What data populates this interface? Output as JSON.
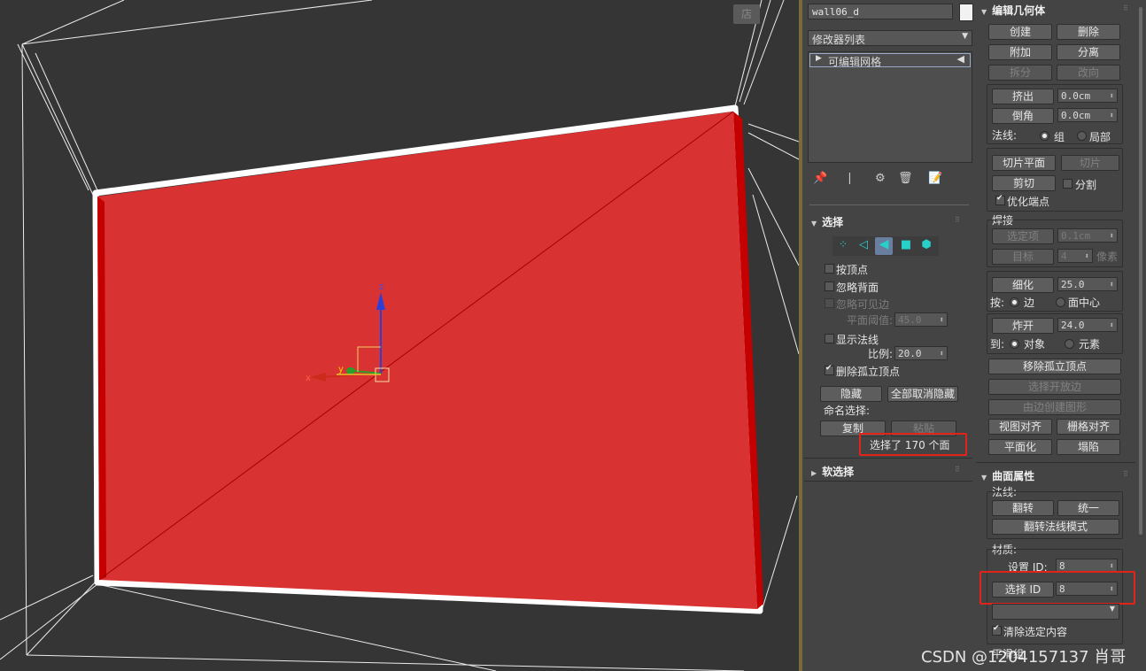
{
  "viewport": {
    "label": "店",
    "axis_x": "x",
    "axis_y": "y",
    "axis_z": "z"
  },
  "object_name": "wall06_d",
  "modifier_list_label": "修改器列表",
  "stack_item": "可编辑网格",
  "selection": {
    "header": "选择",
    "by_vertex": "按顶点",
    "ignore_backface": "忽略背面",
    "ignore_visible_edges": "忽略可见边",
    "planar_threshold_label": "平面阈值:",
    "planar_threshold_value": "45.0",
    "show_normals": "显示法线",
    "scale_label": "比例:",
    "scale_value": "20.0",
    "delete_isolated": "删除孤立顶点",
    "hide": "隐藏",
    "unhide_all": "全部取消隐藏",
    "named_selection": "命名选择:",
    "copy": "复制",
    "paste": "粘贴",
    "status": "选择了 170 个面"
  },
  "soft_selection": {
    "header": "软选择"
  },
  "edit_geometry": {
    "header": "编辑几何体",
    "create": "创建",
    "delete": "删除",
    "attach": "附加",
    "detach": "分离",
    "split": "拆分",
    "turn": "改向",
    "extrude": "挤出",
    "extrude_value": "0.0cm",
    "chamfer": "倒角",
    "chamfer_value": "0.0cm",
    "normals_label": "法线:",
    "group": "组",
    "local": "局部",
    "slice_plane": "切片平面",
    "slice": "切片",
    "cut": "剪切",
    "split_cb": "分割",
    "optimize_end": "优化端点",
    "weld_label": "焊接",
    "selected": "选定项",
    "selected_value": "0.1cm",
    "target": "目标",
    "target_value": "4",
    "pixels": "像素",
    "tessellate": "细化",
    "tessellate_value": "25.0",
    "by_label": "按:",
    "edge": "边",
    "face_center": "面中心",
    "explode": "炸开",
    "explode_value": "24.0",
    "to_label": "到:",
    "object": "对象",
    "element": "元素",
    "remove_isolated": "移除孤立顶点",
    "select_open_edges": "选择开放边",
    "create_shape": "由边创建图形",
    "view_align": "视图对齐",
    "grid_align": "栅格对齐",
    "planarize": "平面化",
    "collapse": "塌陷"
  },
  "surface_properties": {
    "header": "曲面属性",
    "normals_label": "法线:",
    "flip": "翻转",
    "unify": "统一",
    "flip_mode": "翻转法线模式",
    "material_label": "材质:",
    "set_id_label": "设置 ID:",
    "set_id_value": "8",
    "select_id": "选择 ID",
    "select_id_value": "8",
    "clear_selection": "清除选定内容",
    "smoothing_label": "平滑组"
  },
  "watermark": "CSDN @1204157137 肖哥",
  "colors": {
    "mesh_red": "#d93232",
    "highlight_red": "#e2231a",
    "panel_bg": "#444444",
    "viewport_bg": "#353535"
  }
}
